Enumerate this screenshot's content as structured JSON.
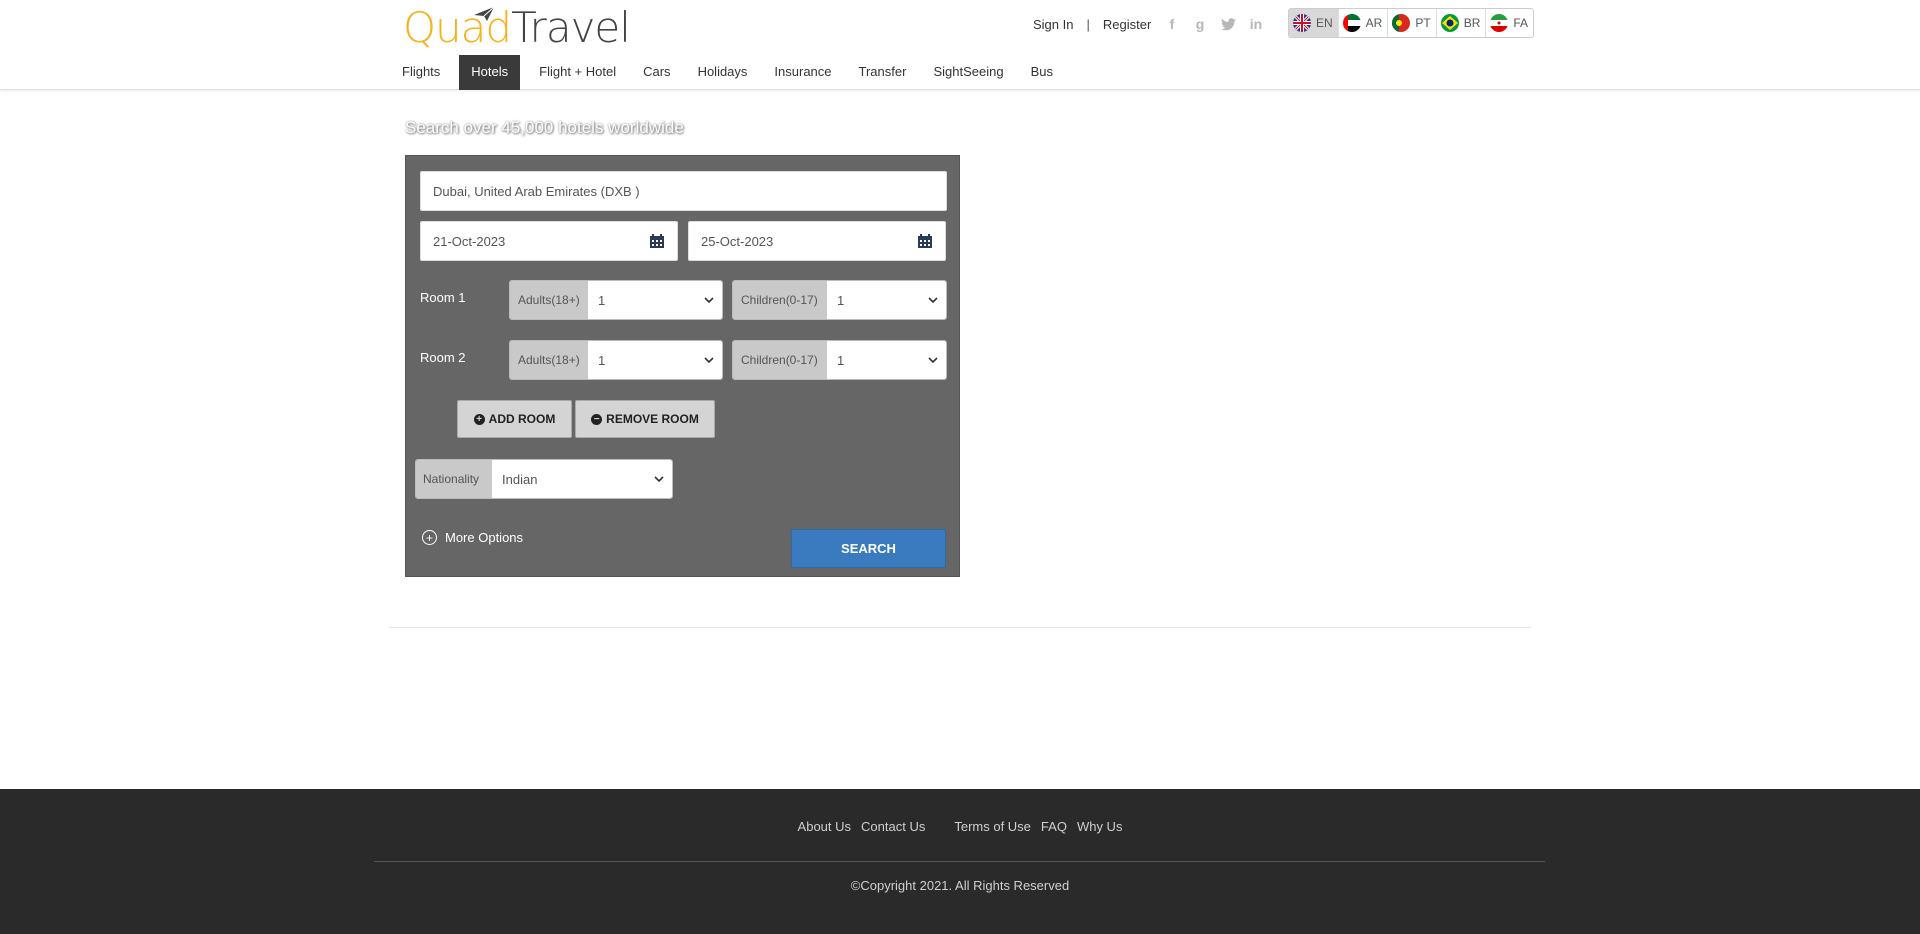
{
  "brand": {
    "part1": "Quad",
    "part2": "Travel"
  },
  "top_links": {
    "sign_in": "Sign In",
    "separator": "|",
    "register": "Register"
  },
  "social": [
    {
      "icon": "facebook-icon",
      "glyph": "f"
    },
    {
      "icon": "google-icon",
      "glyph": "g"
    },
    {
      "icon": "twitter-icon",
      "glyph": "t"
    },
    {
      "icon": "linkedin-icon",
      "glyph": "in"
    }
  ],
  "languages": [
    {
      "code": "EN",
      "flag": "uk-flag-icon",
      "active": true
    },
    {
      "code": "AR",
      "flag": "uae-flag-icon",
      "active": false
    },
    {
      "code": "PT",
      "flag": "portugal-flag-icon",
      "active": false
    },
    {
      "code": "BR",
      "flag": "brazil-flag-icon",
      "active": false
    },
    {
      "code": "FA",
      "flag": "iran-flag-icon",
      "active": false
    }
  ],
  "nav": [
    "Flights",
    "Hotels",
    "Flight + Hotel",
    "Cars",
    "Holidays",
    "Insurance",
    "Transfer",
    "SightSeeing",
    "Bus"
  ],
  "nav_active": "Hotels",
  "search": {
    "tagline": "Search over 45,000 hotels worldwide",
    "destination": "Dubai, United Arab Emirates (DXB )",
    "checkin": "21-Oct-2023",
    "checkout": "25-Oct-2023",
    "rooms": [
      {
        "label": "Room 1",
        "adults_prefix": "Adults(18+)",
        "adults": "1",
        "children_prefix": "Children(0-17)",
        "children": "1"
      },
      {
        "label": "Room 2",
        "adults_prefix": "Adults(18+)",
        "adults": "1",
        "children_prefix": "Children(0-17)",
        "children": "1"
      }
    ],
    "add_room": "ADD ROOM",
    "remove_room": "REMOVE ROOM",
    "nationality_prefix": "Nationality",
    "nationality": "Indian",
    "more_options": "More Options",
    "search_button": "SEARCH"
  },
  "footer": {
    "links": [
      "About Us",
      "Contact Us",
      "Terms of Use",
      "FAQ",
      "Why Us"
    ],
    "copyright": "©Copyright 2021. All Rights Reserved"
  },
  "colors": {
    "brand_yellow": "#f5b21a",
    "panel_bg": "#666666",
    "search_blue": "#3a7bc0",
    "nav_active": "#3a3a3a",
    "footer_bg": "#2a2a2a"
  }
}
